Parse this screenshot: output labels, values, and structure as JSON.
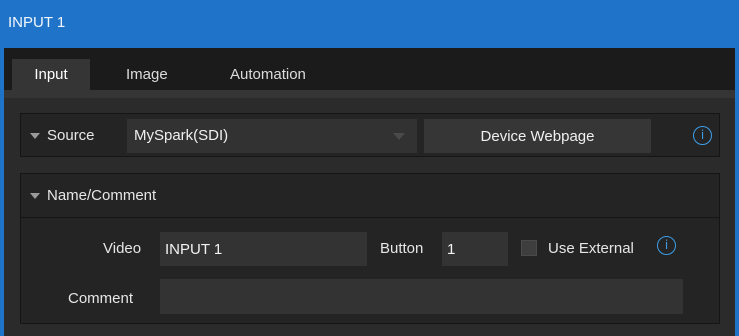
{
  "window": {
    "title": "INPUT 1"
  },
  "tabs": [
    {
      "label": "Input",
      "active": true
    },
    {
      "label": "Image",
      "active": false
    },
    {
      "label": "Automation",
      "active": false
    }
  ],
  "source": {
    "label": "Source",
    "selected": "MySpark(SDI)",
    "device_button": "Device Webpage",
    "info_glyph": "i"
  },
  "name_comment": {
    "header": "Name/Comment",
    "video_label": "Video",
    "video_value": "INPUT 1",
    "button_label": "Button",
    "button_value": "1",
    "use_external_label": "Use External",
    "use_external_checked": false,
    "info_glyph": "i",
    "comment_label": "Comment",
    "comment_value": ""
  },
  "colors": {
    "accent": "#1f74c9",
    "info": "#3d9ee8",
    "background": "#2b2b2b",
    "panel": "#242424"
  }
}
